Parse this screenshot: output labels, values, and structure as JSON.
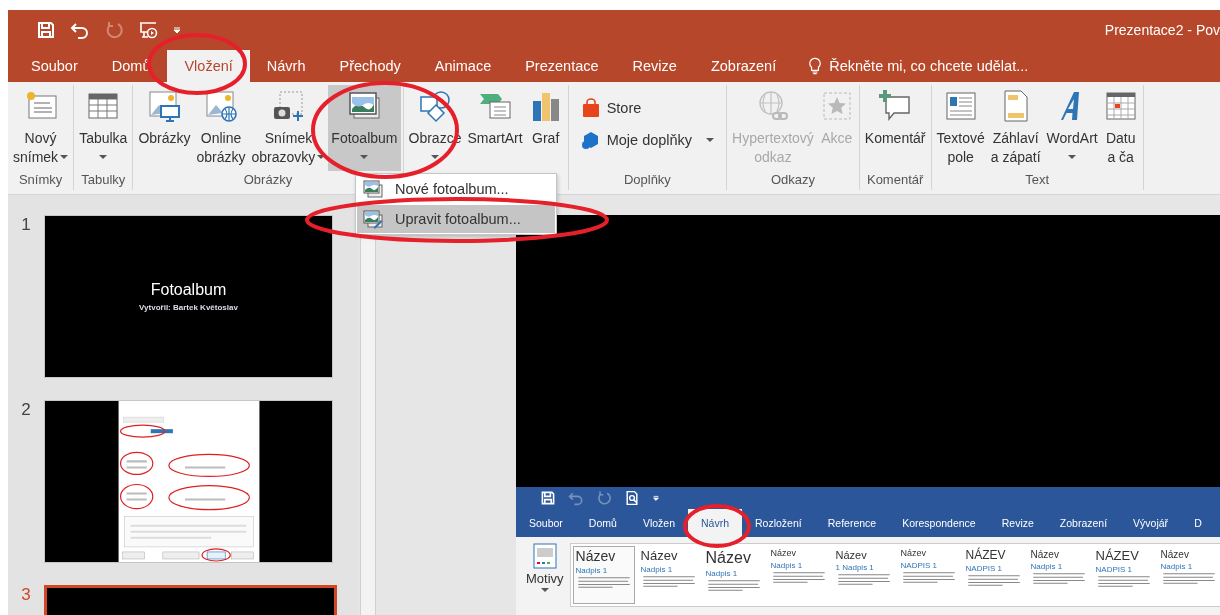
{
  "window": {
    "title": "Prezentace2 - Pov"
  },
  "quick_access": [
    {
      "kind": "save",
      "disabled": false
    },
    {
      "kind": "undo",
      "disabled": false
    },
    {
      "kind": "redo",
      "disabled": true
    },
    {
      "kind": "presenter",
      "disabled": false
    },
    {
      "kind": "customize",
      "disabled": false
    }
  ],
  "tabs": [
    {
      "label": "Soubor",
      "selected": false
    },
    {
      "label": "Domů",
      "selected": false
    },
    {
      "label": "Vložení",
      "selected": true
    },
    {
      "label": "Návrh",
      "selected": false
    },
    {
      "label": "Přechody",
      "selected": false
    },
    {
      "label": "Animace",
      "selected": false
    },
    {
      "label": "Prezentace",
      "selected": false
    },
    {
      "label": "Revize",
      "selected": false
    },
    {
      "label": "Zobrazení",
      "selected": false
    }
  ],
  "tell_me": {
    "placeholder": "Řekněte mi, co chcete udělat..."
  },
  "ribbon": {
    "groups": [
      {
        "label": "Snímky",
        "items": [
          {
            "kind": "large",
            "lines": [
              "Nový",
              "snímek"
            ],
            "dropdown": true,
            "disabled": false,
            "selected": false
          }
        ]
      },
      {
        "label": "Tabulky",
        "items": [
          {
            "kind": "large",
            "lines": [
              "Tabulka"
            ],
            "dropdown": true,
            "disabled": false,
            "selected": false
          }
        ]
      },
      {
        "label": "Obrázky",
        "items": [
          {
            "kind": "large",
            "lines": [
              "Obrázky"
            ],
            "dropdown": false,
            "disabled": false,
            "selected": false
          },
          {
            "kind": "large",
            "lines": [
              "Online",
              "obrázky"
            ],
            "dropdown": false,
            "disabled": false,
            "selected": false
          },
          {
            "kind": "large",
            "lines": [
              "Snímek",
              "obrazovky"
            ],
            "dropdown": true,
            "disabled": false,
            "selected": false
          },
          {
            "kind": "large",
            "lines": [
              "Fotoalbum"
            ],
            "dropdown": true,
            "disabled": false,
            "selected": true
          }
        ]
      },
      {
        "items": [
          {
            "kind": "large",
            "lines": [
              "Obrazce"
            ],
            "dropdown": true,
            "disabled": false,
            "selected": false
          },
          {
            "kind": "large",
            "lines": [
              "SmartArt"
            ],
            "dropdown": false,
            "disabled": false,
            "selected": false
          },
          {
            "kind": "large",
            "lines": [
              "Graf"
            ],
            "dropdown": false,
            "disabled": false,
            "selected": false
          }
        ]
      },
      {
        "label": "Doplňky",
        "items": [
          {
            "kind": "small",
            "lines": [
              "Store"
            ],
            "dropdown": false,
            "disabled": false,
            "selected": false
          },
          {
            "kind": "small",
            "lines": [
              "Moje doplňky"
            ],
            "dropdown": true,
            "disabled": false,
            "selected": false
          }
        ]
      },
      {
        "label": "Odkazy",
        "items": [
          {
            "kind": "large",
            "lines": [
              "Hypertextový",
              "odkaz"
            ],
            "dropdown": false,
            "disabled": true,
            "selected": false
          },
          {
            "kind": "large",
            "lines": [
              "Akce"
            ],
            "dropdown": false,
            "disabled": true,
            "selected": false
          }
        ]
      },
      {
        "label": "Komentář",
        "items": [
          {
            "kind": "large",
            "lines": [
              "Komentář"
            ],
            "dropdown": false,
            "disabled": false,
            "selected": false
          }
        ]
      },
      {
        "label": "Text",
        "items": [
          {
            "kind": "large",
            "lines": [
              "Textové",
              "pole"
            ],
            "dropdown": false,
            "disabled": false,
            "selected": false
          },
          {
            "kind": "large",
            "lines": [
              "Záhlaví",
              "a zápatí"
            ],
            "dropdown": false,
            "disabled": false,
            "selected": false
          },
          {
            "kind": "large",
            "lines": [
              "WordArt"
            ],
            "dropdown": true,
            "disabled": false,
            "selected": false
          },
          {
            "kind": "large",
            "lines": [
              "Datu",
              "a ča"
            ],
            "dropdown": false,
            "disabled": false,
            "selected": false
          }
        ]
      }
    ]
  },
  "menu": {
    "items": [
      {
        "label": "Nové fotoalbum...",
        "selected": false
      },
      {
        "label": "Upravit fotoalbum...",
        "selected": true
      }
    ]
  },
  "slides": [
    {
      "number": "1",
      "selected": false,
      "kind": "title",
      "title": "Fotoalbum",
      "subtitle": "Vytvořil: Bartek Květoslav"
    },
    {
      "number": "2",
      "selected": false,
      "kind": "screenshot"
    },
    {
      "number": "3",
      "selected": true,
      "kind": "blank"
    }
  ],
  "current_slide": {
    "word_screenshot": {
      "quick_access": [
        {
          "kind": "save",
          "disabled": false
        },
        {
          "kind": "undo",
          "disabled": true
        },
        {
          "kind": "redo",
          "disabled": true
        },
        {
          "kind": "preview",
          "disabled": false
        },
        {
          "kind": "customize",
          "disabled": false
        }
      ],
      "tabs": [
        {
          "label": "Soubor",
          "selected": false
        },
        {
          "label": "Domů",
          "selected": false
        },
        {
          "label": "Vložen",
          "selected": false
        },
        {
          "label": "Návrh",
          "selected": true
        },
        {
          "label": "Rozložení",
          "selected": false
        },
        {
          "label": "Reference",
          "selected": false
        },
        {
          "label": "Korespondence",
          "selected": false
        },
        {
          "label": "Revize",
          "selected": false
        },
        {
          "label": "Zobrazení",
          "selected": false
        },
        {
          "label": "Vývojář",
          "selected": false
        },
        {
          "label": "D",
          "selected": false
        }
      ],
      "themes_button": "Motivy",
      "themes": [
        {
          "title": "Název",
          "heading": "Nadpis 1",
          "selected": true
        },
        {
          "title": "Název",
          "heading": "Nadpis 1",
          "selected": false
        },
        {
          "title": "Název",
          "heading": "Nadpis 1",
          "selected": false
        },
        {
          "title": "Název",
          "heading": "Nadpis 1",
          "selected": false
        },
        {
          "title": "Název",
          "heading": "1 Nadpis 1",
          "selected": false
        },
        {
          "title": "Název",
          "heading": "NADPIS 1",
          "selected": false
        },
        {
          "title": "NÁZEV",
          "heading": "NADPIS 1",
          "selected": false
        },
        {
          "title": "Název",
          "heading": "Nadpis 1",
          "selected": false
        },
        {
          "title": "NÁZEV",
          "heading": "NADPIS 1",
          "selected": false
        },
        {
          "title": "Název",
          "heading": "Nadpis 1",
          "selected": false
        }
      ]
    }
  }
}
